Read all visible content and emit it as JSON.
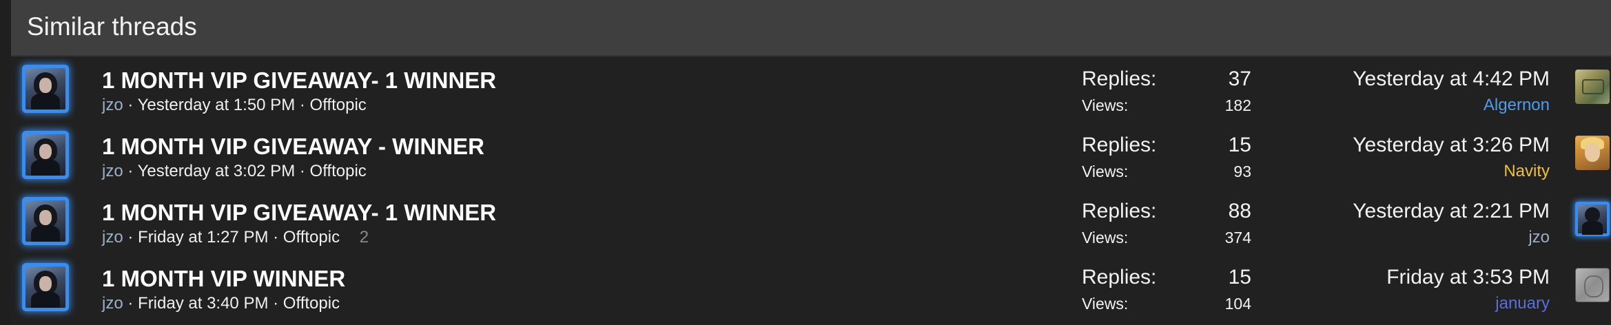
{
  "block": {
    "title": "Similar threads"
  },
  "labels": {
    "replies": "Replies:",
    "views": "Views:",
    "separator": "·"
  },
  "threads": [
    {
      "title": "1 MONTH VIP GIVEAWAY- 1 WINNER",
      "author": "jzo",
      "started": "Yesterday at 1:50 PM",
      "forum": "Offtopic",
      "pages": "",
      "replies": "37",
      "views": "182",
      "last_post_time": "Yesterday at 4:42 PM",
      "last_poster": "Algernon",
      "last_poster_color": "#4a9ef0",
      "last_poster_avatar": "algernon-avatar"
    },
    {
      "title": "1 MONTH VIP GIVEAWAY - WINNER",
      "author": "jzo",
      "started": "Yesterday at 3:02 PM",
      "forum": "Offtopic",
      "pages": "",
      "replies": "15",
      "views": "93",
      "last_post_time": "Yesterday at 3:26 PM",
      "last_poster": "Navity",
      "last_poster_color": "#f0c23c",
      "last_poster_avatar": "navity-avatar"
    },
    {
      "title": "1 MONTH VIP GIVEAWAY- 1 WINNER",
      "author": "jzo",
      "started": "Friday at 1:27 PM",
      "forum": "Offtopic",
      "pages": "2",
      "replies": "88",
      "views": "374",
      "last_post_time": "Yesterday at 2:21 PM",
      "last_poster": "jzo",
      "last_poster_color": "#9bb0c8",
      "last_poster_avatar": "jzo-avatar"
    },
    {
      "title": "1 MONTH VIP WINNER",
      "author": "jzo",
      "started": "Friday at 3:40 PM",
      "forum": "Offtopic",
      "pages": "",
      "replies": "15",
      "views": "104",
      "last_post_time": "Friday at 3:53 PM",
      "last_poster": "january",
      "last_poster_color": "#5a6ee0",
      "last_poster_avatar": "january-avatar"
    }
  ]
}
